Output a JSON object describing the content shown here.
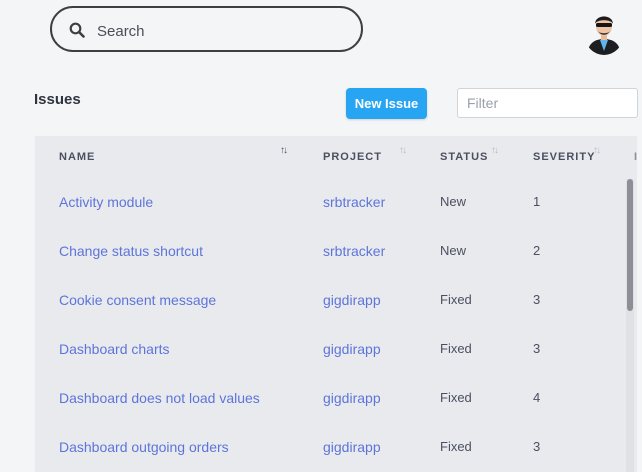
{
  "search": {
    "placeholder": "Search"
  },
  "header": {
    "title": "Issues",
    "new_issue_label": "New Issue",
    "filter_placeholder": "Filter"
  },
  "table": {
    "columns": [
      {
        "label": "NAME",
        "sort": "ascending"
      },
      {
        "label": "PROJECT",
        "sort": "none"
      },
      {
        "label": "STATUS",
        "sort": "none"
      },
      {
        "label": "SEVERITY",
        "sort": "none"
      },
      {
        "label": "",
        "sort": "none"
      }
    ],
    "rows": [
      {
        "name": "Activity module",
        "project": "srbtracker",
        "status": "New",
        "severity": "1"
      },
      {
        "name": "Change status shortcut",
        "project": "srbtracker",
        "status": "New",
        "severity": "2"
      },
      {
        "name": "Cookie consent message",
        "project": "gigdirapp",
        "status": "Fixed",
        "severity": "3"
      },
      {
        "name": "Dashboard charts",
        "project": "gigdirapp",
        "status": "Fixed",
        "severity": "3"
      },
      {
        "name": "Dashboard does not load values",
        "project": "gigdirapp",
        "status": "Fixed",
        "severity": "4"
      },
      {
        "name": "Dashboard outgoing orders",
        "project": "gigdirapp",
        "status": "Fixed",
        "severity": "3"
      }
    ]
  },
  "colors": {
    "accent": "#27a4f2",
    "link": "#5d75d9",
    "table_bg": "#e9eaee"
  }
}
